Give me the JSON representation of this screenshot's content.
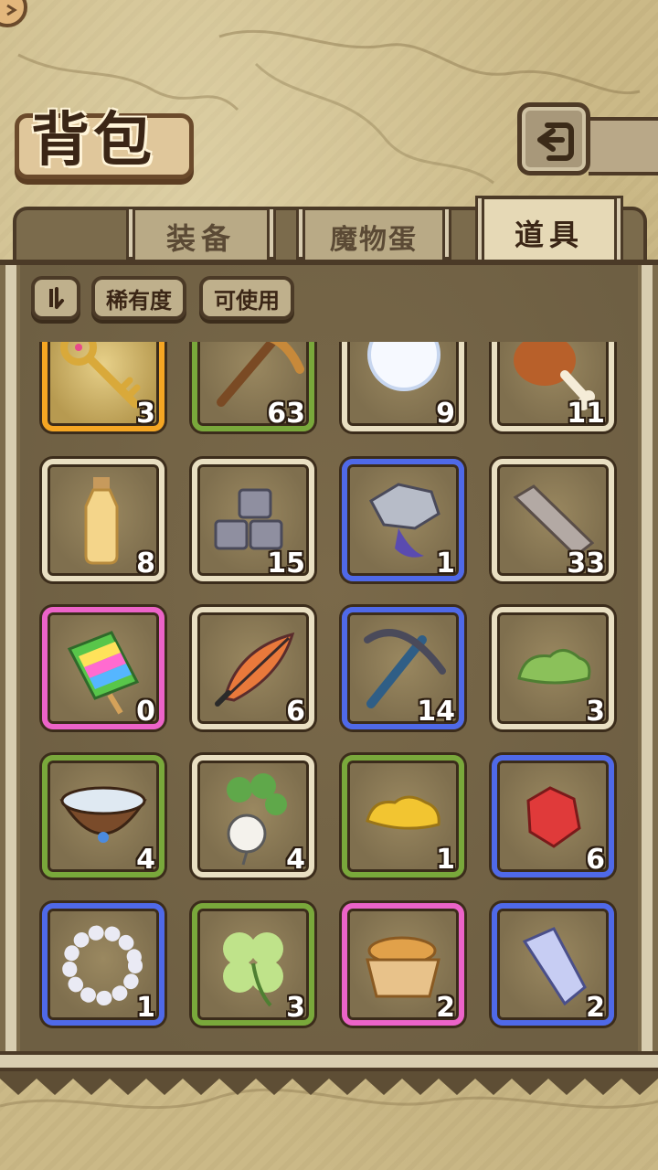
{
  "header": {
    "title": "背包"
  },
  "tabs": [
    {
      "label": "装备",
      "active": false
    },
    {
      "label": "魔物蛋",
      "active": false
    },
    {
      "label": "道具",
      "active": true
    }
  ],
  "filters": {
    "rarity_label": "稀有度",
    "usable_label": "可使用"
  },
  "colors": {
    "orange": "#f5a623",
    "green": "#79a83b",
    "blue": "#4f69e8",
    "pink": "#ec63c8",
    "plain": "#e9dfc2"
  },
  "items": [
    {
      "name": "golden-key",
      "rarity": "orange",
      "count": "3"
    },
    {
      "name": "pickaxe-wood",
      "rarity": "green",
      "count": "63"
    },
    {
      "name": "snowball",
      "rarity": "plain",
      "count": "9"
    },
    {
      "name": "meat-drumstick",
      "rarity": "plain",
      "count": "11"
    },
    {
      "name": "potion-bottle",
      "rarity": "plain",
      "count": "8"
    },
    {
      "name": "stone-bricks",
      "rarity": "plain",
      "count": "15"
    },
    {
      "name": "metal-scrap",
      "rarity": "blue",
      "count": "1"
    },
    {
      "name": "stone-slab",
      "rarity": "plain",
      "count": "33"
    },
    {
      "name": "rainbow-popsicle",
      "rarity": "pink",
      "count": "0"
    },
    {
      "name": "feather",
      "rarity": "plain",
      "count": "6"
    },
    {
      "name": "pickaxe-iron",
      "rarity": "blue",
      "count": "14"
    },
    {
      "name": "green-slime",
      "rarity": "plain",
      "count": "3"
    },
    {
      "name": "water-bowl",
      "rarity": "green",
      "count": "4"
    },
    {
      "name": "radish",
      "rarity": "plain",
      "count": "4"
    },
    {
      "name": "gold-blob",
      "rarity": "green",
      "count": "1"
    },
    {
      "name": "red-gem",
      "rarity": "blue",
      "count": "6"
    },
    {
      "name": "pearl-bracelet",
      "rarity": "blue",
      "count": "1"
    },
    {
      "name": "four-leaf-clover",
      "rarity": "green",
      "count": "3"
    },
    {
      "name": "bread-basket",
      "rarity": "pink",
      "count": "2"
    },
    {
      "name": "crystal-shard",
      "rarity": "blue",
      "count": "2"
    }
  ]
}
